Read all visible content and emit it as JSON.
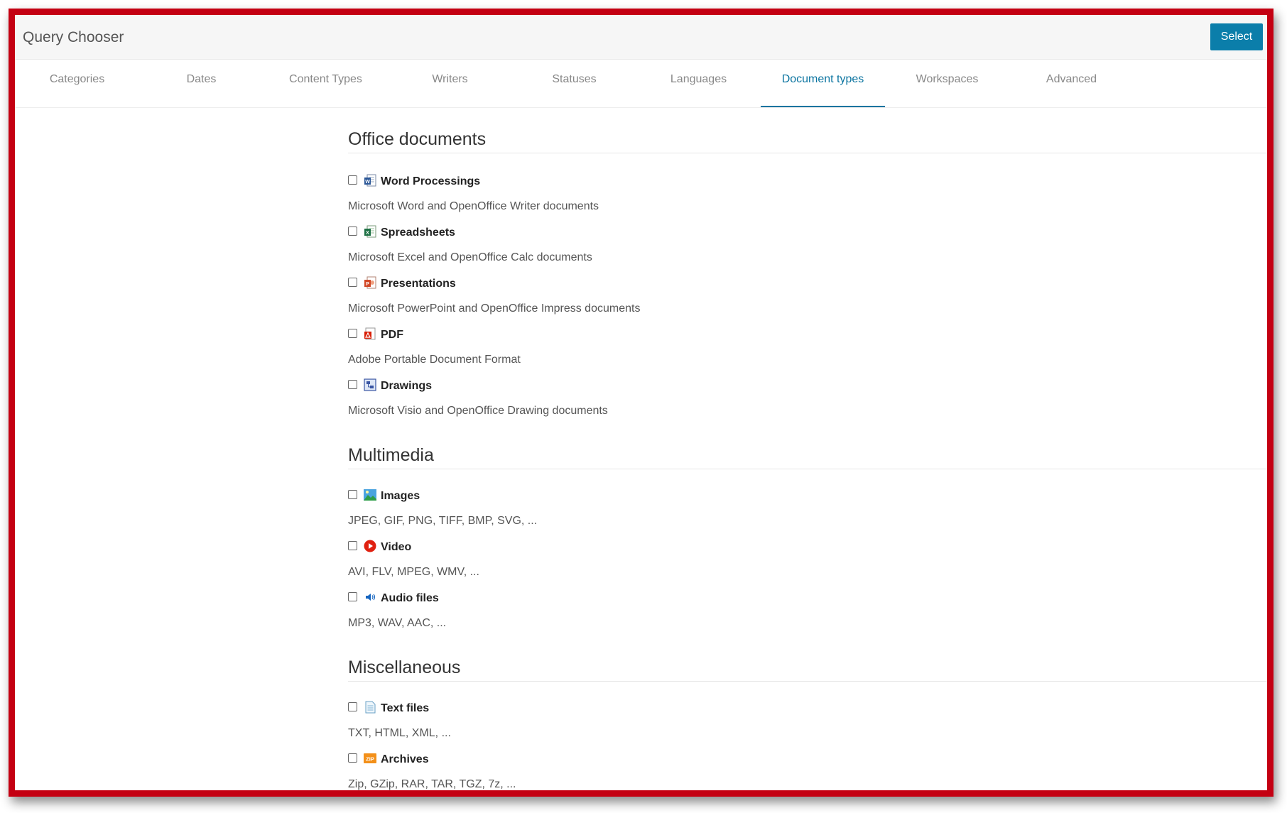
{
  "window": {
    "title": "Query Chooser",
    "select_label": "Select"
  },
  "tabs": [
    {
      "label": "Categories"
    },
    {
      "label": "Dates"
    },
    {
      "label": "Content Types"
    },
    {
      "label": "Writers"
    },
    {
      "label": "Statuses"
    },
    {
      "label": "Languages"
    },
    {
      "label": "Document types",
      "active": true
    },
    {
      "label": "Workspaces"
    },
    {
      "label": "Advanced"
    }
  ],
  "sections": [
    {
      "title": "Office documents",
      "items": [
        {
          "label": "Word Processings",
          "desc": "Microsoft Word and OpenOffice Writer documents",
          "icon": "word-icon",
          "checked": false
        },
        {
          "label": "Spreadsheets",
          "desc": "Microsoft Excel and OpenOffice Calc documents",
          "icon": "excel-icon",
          "checked": false
        },
        {
          "label": "Presentations",
          "desc": "Microsoft PowerPoint and OpenOffice Impress documents",
          "icon": "powerpoint-icon",
          "checked": false
        },
        {
          "label": "PDF",
          "desc": "Adobe Portable Document Format",
          "icon": "pdf-icon",
          "checked": false
        },
        {
          "label": "Drawings",
          "desc": "Microsoft Visio and OpenOffice Drawing documents",
          "icon": "visio-icon",
          "checked": false
        }
      ]
    },
    {
      "title": "Multimedia",
      "items": [
        {
          "label": "Images",
          "desc": "JPEG, GIF, PNG, TIFF, BMP, SVG, ...",
          "icon": "image-icon",
          "checked": false
        },
        {
          "label": "Video",
          "desc": "AVI, FLV, MPEG, WMV, ...",
          "icon": "video-icon",
          "checked": false
        },
        {
          "label": "Audio files",
          "desc": "MP3, WAV, AAC, ...",
          "icon": "audio-icon",
          "checked": false
        }
      ]
    },
    {
      "title": "Miscellaneous",
      "items": [
        {
          "label": "Text files",
          "desc": "TXT, HTML, XML, ...",
          "icon": "text-file-icon",
          "checked": false
        },
        {
          "label": "Archives",
          "desc": "Zip, GZip, RAR, TAR, TGZ, 7z, ...",
          "icon": "zip-icon",
          "checked": false
        }
      ]
    }
  ],
  "colors": {
    "accent": "#0b7eaa",
    "frame": "#c40012"
  }
}
